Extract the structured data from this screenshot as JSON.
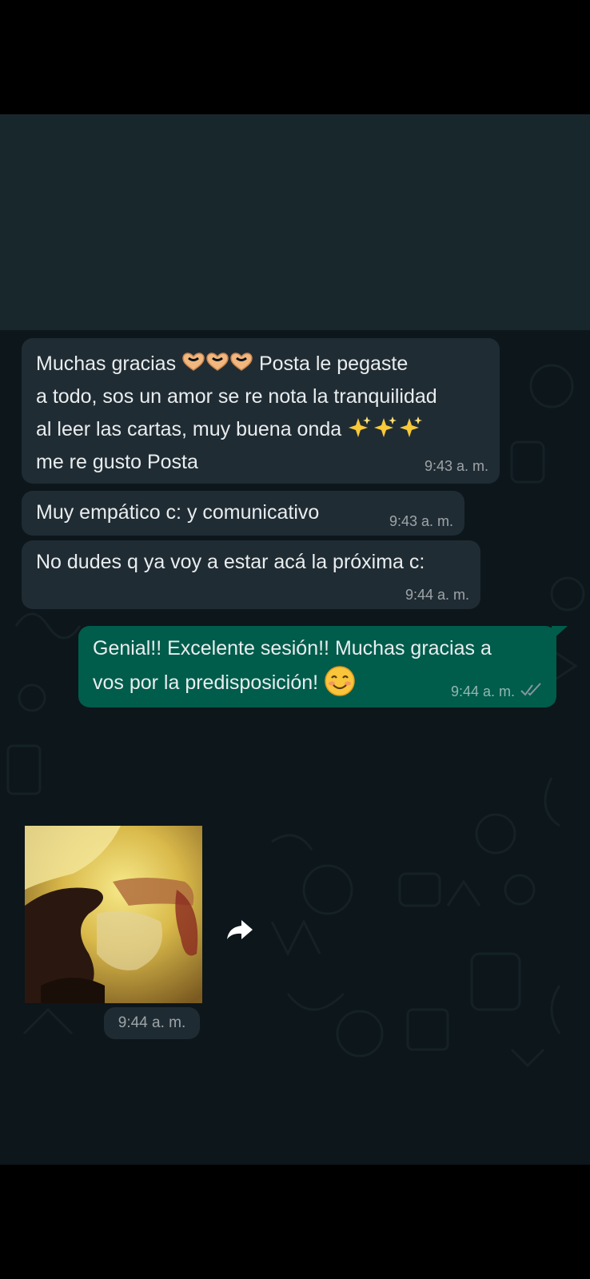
{
  "messages": [
    {
      "direction": "incoming",
      "line1_before": "Muchas gracias ",
      "line1_after": " Posta le pegaste",
      "line2": "a todo, sos un amor se re nota la tranquilidad",
      "line3": "al leer las cartas, muy buena onda ",
      "line4": "me re gusto Posta",
      "heart_emoji_count": 3,
      "sparkle_emoji_count": 3,
      "time": "9:43 a. m."
    },
    {
      "direction": "incoming",
      "text": "Muy empático c: y comunicativo",
      "time": "9:43 a. m."
    },
    {
      "direction": "incoming",
      "text": "No dudes q ya voy a estar acá la próxima c:",
      "time": "9:44 a. m."
    },
    {
      "direction": "outgoing",
      "line1": "Genial!! Excelente sesión!! Muchas gracias a",
      "line2": "vos por la predisposición! ",
      "emoji": "smiling-face-with-smiling-eyes",
      "time": "9:44 a. m.",
      "status": "read"
    },
    {
      "direction": "incoming",
      "type": "media",
      "time": "9:44 a. m."
    }
  ],
  "colors": {
    "incoming_bubble": "#202c33",
    "outgoing_bubble": "#005c4b",
    "chat_background": "#0c161b",
    "read_ticks": "#8696a0"
  },
  "icons": {
    "forward": "forward-icon",
    "read_receipt": "double-check-icon"
  }
}
